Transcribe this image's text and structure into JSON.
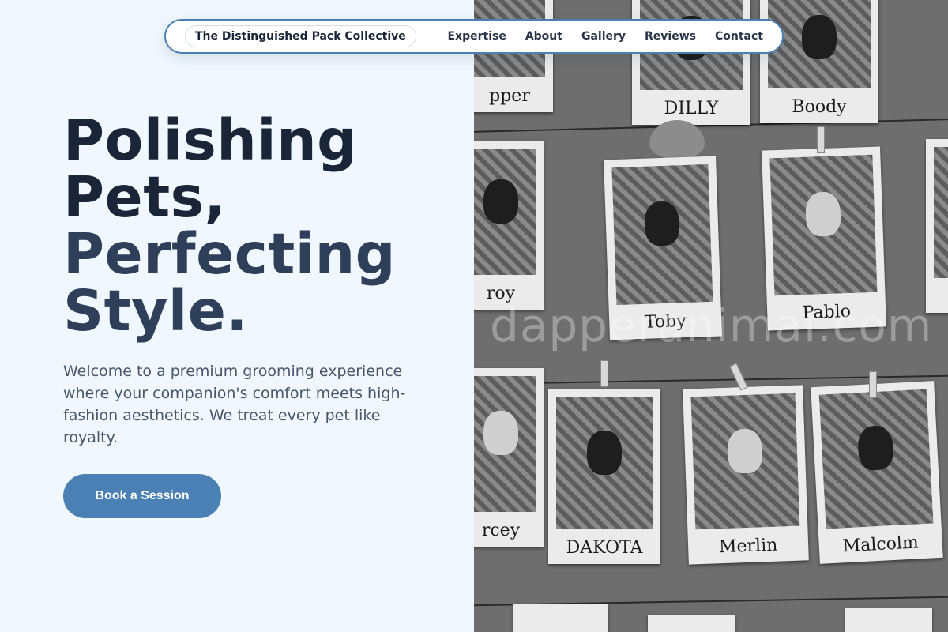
{
  "nav": {
    "brand": "The Distinguished Pack Collective",
    "links": [
      "Expertise",
      "About",
      "Gallery",
      "Reviews",
      "Contact"
    ]
  },
  "hero": {
    "title_line1": "Polishing Pets,",
    "title_line2": "Perfecting Style.",
    "subtitle": "Welcome to a premium grooming experience where your companion's comfort meets high-fashion aesthetics. We treat every pet like royalty.",
    "cta": "Book a Session"
  },
  "gallery": {
    "watermark": "dapperanimal.com",
    "names": [
      "pper",
      "DILLY",
      "Boody",
      "roy",
      "Toby",
      "Pablo",
      "rcey",
      "DAKOTA",
      "Merlin",
      "Malcolm"
    ]
  },
  "colors": {
    "accent": "#4a80b4",
    "background": "#f0f7fe",
    "heading": "#1b2538"
  }
}
